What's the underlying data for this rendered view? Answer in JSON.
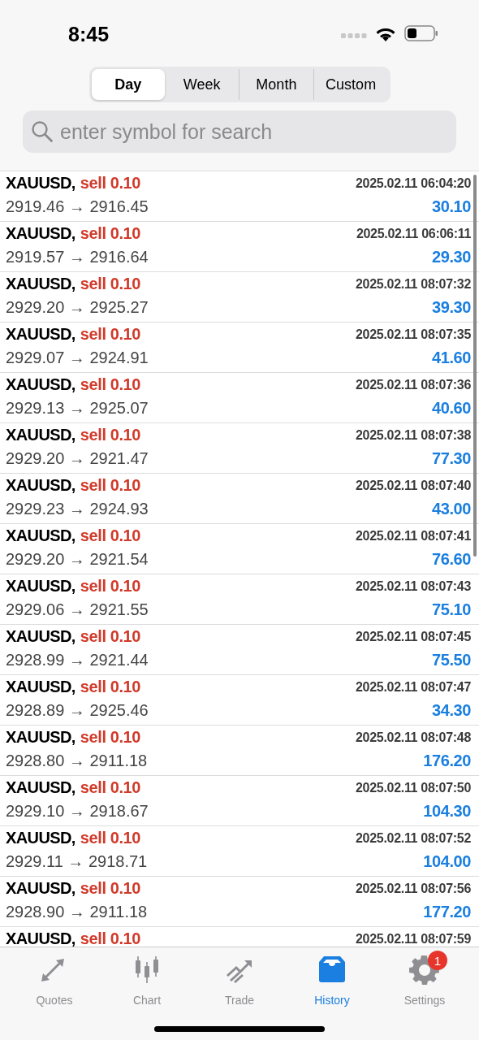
{
  "status_bar": {
    "time": "8:45"
  },
  "period_tabs": [
    {
      "label": "Day",
      "selected": true
    },
    {
      "label": "Week",
      "selected": false
    },
    {
      "label": "Month",
      "selected": false
    },
    {
      "label": "Custom",
      "selected": false
    }
  ],
  "search": {
    "placeholder": "enter symbol for search"
  },
  "deals": [
    {
      "symbol": "XAUUSD,",
      "kind": "sell",
      "order": "sell 0.10",
      "time": "2025.02.11 06:04:20",
      "prices": "2919.46 → 2916.45",
      "profit": "30.10"
    },
    {
      "symbol": "XAUUSD,",
      "kind": "sell",
      "order": "sell 0.10",
      "time": "2025.02.11 06:06:11",
      "prices": "2919.57 → 2916.64",
      "profit": "29.30"
    },
    {
      "symbol": "XAUUSD,",
      "kind": "sell",
      "order": "sell 0.10",
      "time": "2025.02.11 08:07:32",
      "prices": "2929.20 → 2925.27",
      "profit": "39.30"
    },
    {
      "symbol": "XAUUSD,",
      "kind": "sell",
      "order": "sell 0.10",
      "time": "2025.02.11 08:07:35",
      "prices": "2929.07 → 2924.91",
      "profit": "41.60"
    },
    {
      "symbol": "XAUUSD,",
      "kind": "sell",
      "order": "sell 0.10",
      "time": "2025.02.11 08:07:36",
      "prices": "2929.13 → 2925.07",
      "profit": "40.60"
    },
    {
      "symbol": "XAUUSD,",
      "kind": "sell",
      "order": "sell 0.10",
      "time": "2025.02.11 08:07:38",
      "prices": "2929.20 → 2921.47",
      "profit": "77.30"
    },
    {
      "symbol": "XAUUSD,",
      "kind": "sell",
      "order": "sell 0.10",
      "time": "2025.02.11 08:07:40",
      "prices": "2929.23 → 2924.93",
      "profit": "43.00"
    },
    {
      "symbol": "XAUUSD,",
      "kind": "sell",
      "order": "sell 0.10",
      "time": "2025.02.11 08:07:41",
      "prices": "2929.20 → 2921.54",
      "profit": "76.60"
    },
    {
      "symbol": "XAUUSD,",
      "kind": "sell",
      "order": "sell 0.10",
      "time": "2025.02.11 08:07:43",
      "prices": "2929.06 → 2921.55",
      "profit": "75.10"
    },
    {
      "symbol": "XAUUSD,",
      "kind": "sell",
      "order": "sell 0.10",
      "time": "2025.02.11 08:07:45",
      "prices": "2928.99 → 2921.44",
      "profit": "75.50"
    },
    {
      "symbol": "XAUUSD,",
      "kind": "sell",
      "order": "sell 0.10",
      "time": "2025.02.11 08:07:47",
      "prices": "2928.89 → 2925.46",
      "profit": "34.30"
    },
    {
      "symbol": "XAUUSD,",
      "kind": "sell",
      "order": "sell 0.10",
      "time": "2025.02.11 08:07:48",
      "prices": "2928.80 → 2911.18",
      "profit": "176.20"
    },
    {
      "symbol": "XAUUSD,",
      "kind": "sell",
      "order": "sell 0.10",
      "time": "2025.02.11 08:07:50",
      "prices": "2929.10 → 2918.67",
      "profit": "104.30"
    },
    {
      "symbol": "XAUUSD,",
      "kind": "sell",
      "order": "sell 0.10",
      "time": "2025.02.11 08:07:52",
      "prices": "2929.11 → 2918.71",
      "profit": "104.00"
    },
    {
      "symbol": "XAUUSD,",
      "kind": "sell",
      "order": "sell 0.10",
      "time": "2025.02.11 08:07:56",
      "prices": "2928.90 → 2911.18",
      "profit": "177.20"
    },
    {
      "symbol": "XAUUSD,",
      "kind": "sell",
      "order": "sell 0.10",
      "time": "2025.02.11 08:07:59"
    }
  ],
  "tab_bar": [
    {
      "label": "Quotes",
      "kind": "quotes",
      "selected": false
    },
    {
      "label": "Chart",
      "kind": "chart",
      "selected": false
    },
    {
      "label": "Trade",
      "kind": "trade",
      "selected": false
    },
    {
      "label": "History",
      "kind": "history",
      "selected": true
    },
    {
      "label": "Settings",
      "kind": "settings",
      "selected": false,
      "badge": "1"
    }
  ]
}
